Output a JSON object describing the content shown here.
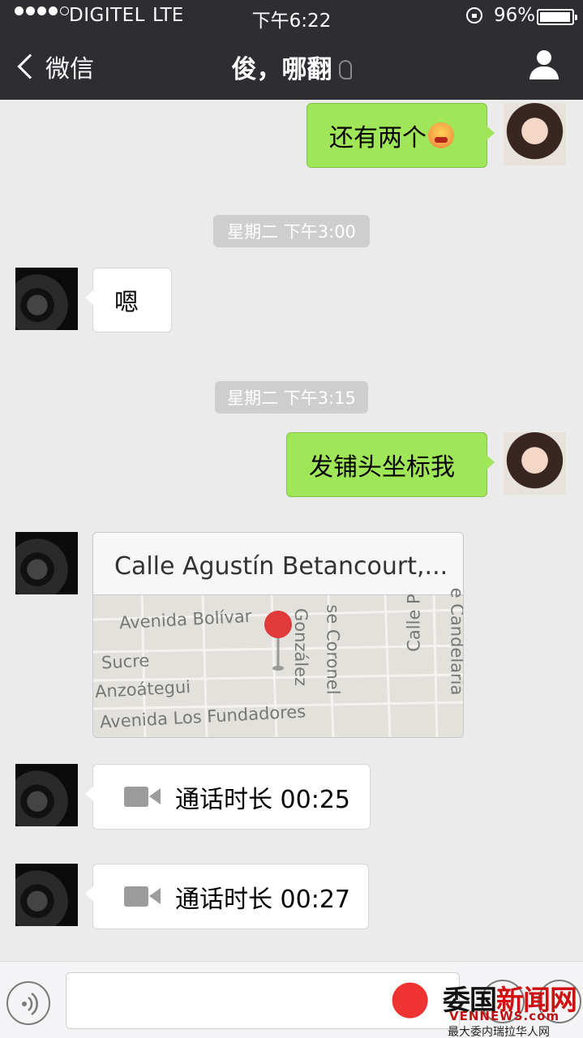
{
  "status_bar": {
    "carrier": "DIGITEL",
    "network": "LTE",
    "time": "下午6:22",
    "battery": "96%",
    "signal_bars_filled": 4,
    "signal_bars_total": 5
  },
  "nav": {
    "back_label": "微信",
    "title": "俊，哪翻"
  },
  "messages": {
    "m1": {
      "sender": "me",
      "text": "还有两个",
      "emoji": "angry-face"
    },
    "ts1": "星期二 下午3:00",
    "m2": {
      "sender": "friend",
      "text": "嗯"
    },
    "ts2": "星期二 下午3:15",
    "m3": {
      "sender": "me",
      "text": "发铺头坐标我"
    },
    "m4": {
      "sender": "friend",
      "type": "location",
      "title": "Calle Agustín Betancourt,...",
      "streets": [
        "Avenida Bolívar",
        "Sucre",
        "Anzoátegui",
        "Avenida Los Fundadores",
        "González",
        "se Coronel",
        "Calle P",
        "e Candelaria"
      ]
    },
    "m5": {
      "sender": "friend",
      "type": "video-call",
      "text": "通话时长 00:25"
    },
    "m6": {
      "sender": "friend",
      "type": "video-call",
      "text": "通话时长 00:27"
    }
  },
  "watermark": {
    "cn_black": "委国",
    "cn_red": "新闻网",
    "en": "VENNEWS.com",
    "sub": "最大委内瑞拉华人网"
  },
  "colors": {
    "nav_bg": "#2e2e32",
    "chat_bg": "#ebebeb",
    "my_bubble": "#9fe658",
    "friend_bubble": "#ffffff",
    "timestamp_bg": "#cecece",
    "map_pin": "#e03a3a"
  }
}
